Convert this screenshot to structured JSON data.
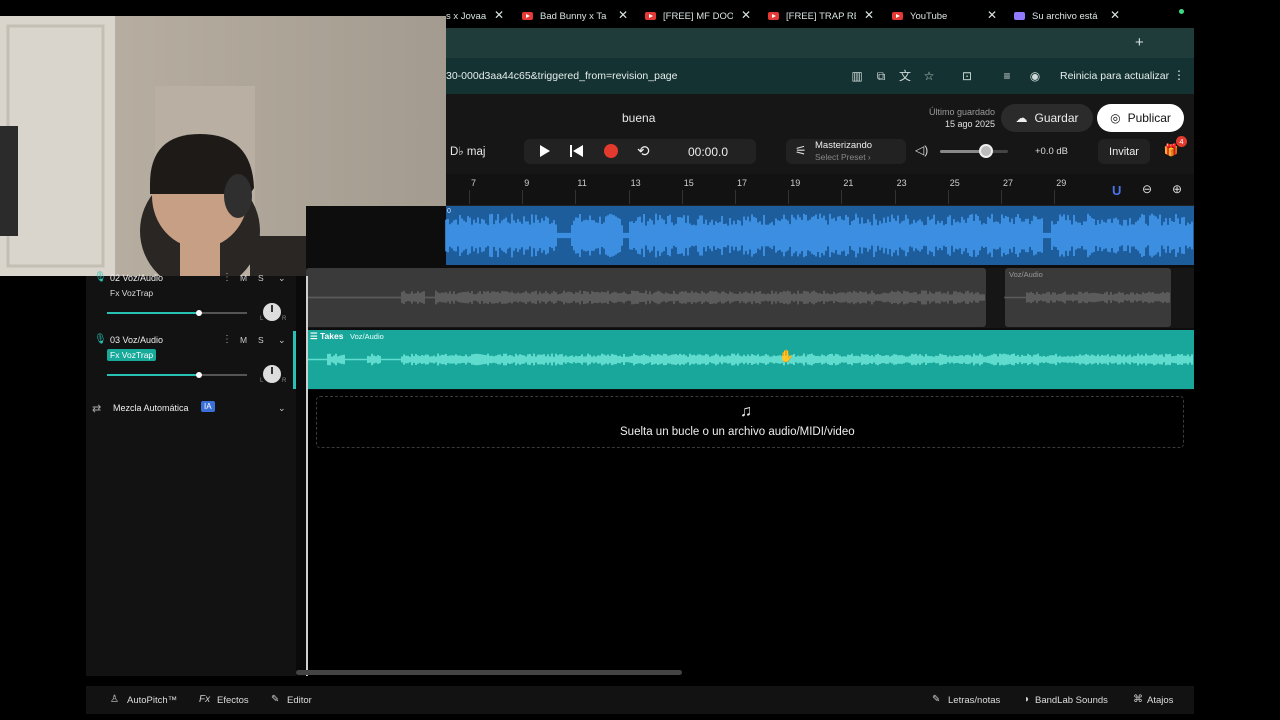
{
  "browser": {
    "tabs": [
      {
        "label": "s x Jovaa",
        "icon": "youtube-icon"
      },
      {
        "label": "Bad Bunny x Ta",
        "icon": "youtube-icon"
      },
      {
        "label": "[FREE] MF DOO",
        "icon": "youtube-icon"
      },
      {
        "label": "[FREE] TRAP RE",
        "icon": "youtube-icon"
      },
      {
        "label": "YouTube",
        "icon": "youtube-icon"
      },
      {
        "label": "Su archivo está",
        "icon": "document-icon"
      }
    ],
    "new_tab": "+",
    "close_glyph": "✕",
    "url": "30-000d3aa44c65&triggered_from=revision_page",
    "restart_label": "Reinicia para actualizar",
    "menu_glyph": "⋮"
  },
  "header": {
    "project_title": "buena",
    "last_saved_label": "Último guardado",
    "last_saved_date": "15 ago 2025",
    "save_label": "Guardar",
    "publish_label": "Publicar",
    "key": "D♭ maj",
    "time": "00:00.0",
    "mastering_title": "Masterizando",
    "mastering_sub": "Select Preset ›",
    "master_volume_fraction": 0.68,
    "db": "+0.0 dB",
    "invite_label": "Invitar",
    "notifications_count": "4"
  },
  "ruler": {
    "ticks": [
      "7",
      "9",
      "11",
      "13",
      "15",
      "17",
      "19",
      "21",
      "23",
      "25",
      "27",
      "29"
    ]
  },
  "tracks": [
    {
      "number_name": "02  Voz/Audio",
      "fx": "Fx VozTrap",
      "fx_highlight": false,
      "volume": 0.66
    },
    {
      "number_name": "03  Voz/Audio",
      "fx": "Fx VozTrap",
      "fx_highlight": true,
      "volume": 0.66
    }
  ],
  "track_controls": {
    "mute": "M",
    "solo": "S",
    "left": "L",
    "right": "R"
  },
  "clips": {
    "track1_label": "0",
    "track2_clip_name": "Voz/Audio",
    "takes_label": "Takes",
    "takes_clip_name": "Voz/Audio"
  },
  "automix": {
    "label": "Mezcla Automática",
    "badge": "IA"
  },
  "dropzone": {
    "text": "Suelta un bucle o un archivo audio/MIDI/video"
  },
  "bottom": {
    "autopitch": "AutoPitch™",
    "effects": "Efectos",
    "editor": "Editor",
    "lyrics": "Letras/notas",
    "sounds": "BandLab Sounds",
    "shortcuts": "Atajos"
  },
  "colors": {
    "track1": "#1d5d9c",
    "track3": "#1aa79b",
    "record": "#e23b2e",
    "accent": "#27c2b4"
  }
}
